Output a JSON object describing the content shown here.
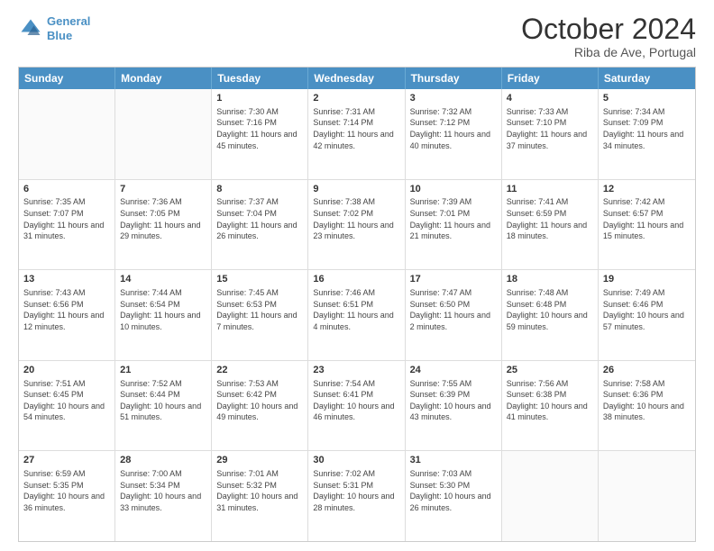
{
  "header": {
    "logo_line1": "General",
    "logo_line2": "Blue",
    "month_title": "October 2024",
    "location": "Riba de Ave, Portugal"
  },
  "days_of_week": [
    "Sunday",
    "Monday",
    "Tuesday",
    "Wednesday",
    "Thursday",
    "Friday",
    "Saturday"
  ],
  "weeks": [
    [
      {
        "day": "",
        "sunrise": "",
        "sunset": "",
        "daylight": ""
      },
      {
        "day": "",
        "sunrise": "",
        "sunset": "",
        "daylight": ""
      },
      {
        "day": "1",
        "sunrise": "Sunrise: 7:30 AM",
        "sunset": "Sunset: 7:16 PM",
        "daylight": "Daylight: 11 hours and 45 minutes."
      },
      {
        "day": "2",
        "sunrise": "Sunrise: 7:31 AM",
        "sunset": "Sunset: 7:14 PM",
        "daylight": "Daylight: 11 hours and 42 minutes."
      },
      {
        "day": "3",
        "sunrise": "Sunrise: 7:32 AM",
        "sunset": "Sunset: 7:12 PM",
        "daylight": "Daylight: 11 hours and 40 minutes."
      },
      {
        "day": "4",
        "sunrise": "Sunrise: 7:33 AM",
        "sunset": "Sunset: 7:10 PM",
        "daylight": "Daylight: 11 hours and 37 minutes."
      },
      {
        "day": "5",
        "sunrise": "Sunrise: 7:34 AM",
        "sunset": "Sunset: 7:09 PM",
        "daylight": "Daylight: 11 hours and 34 minutes."
      }
    ],
    [
      {
        "day": "6",
        "sunrise": "Sunrise: 7:35 AM",
        "sunset": "Sunset: 7:07 PM",
        "daylight": "Daylight: 11 hours and 31 minutes."
      },
      {
        "day": "7",
        "sunrise": "Sunrise: 7:36 AM",
        "sunset": "Sunset: 7:05 PM",
        "daylight": "Daylight: 11 hours and 29 minutes."
      },
      {
        "day": "8",
        "sunrise": "Sunrise: 7:37 AM",
        "sunset": "Sunset: 7:04 PM",
        "daylight": "Daylight: 11 hours and 26 minutes."
      },
      {
        "day": "9",
        "sunrise": "Sunrise: 7:38 AM",
        "sunset": "Sunset: 7:02 PM",
        "daylight": "Daylight: 11 hours and 23 minutes."
      },
      {
        "day": "10",
        "sunrise": "Sunrise: 7:39 AM",
        "sunset": "Sunset: 7:01 PM",
        "daylight": "Daylight: 11 hours and 21 minutes."
      },
      {
        "day": "11",
        "sunrise": "Sunrise: 7:41 AM",
        "sunset": "Sunset: 6:59 PM",
        "daylight": "Daylight: 11 hours and 18 minutes."
      },
      {
        "day": "12",
        "sunrise": "Sunrise: 7:42 AM",
        "sunset": "Sunset: 6:57 PM",
        "daylight": "Daylight: 11 hours and 15 minutes."
      }
    ],
    [
      {
        "day": "13",
        "sunrise": "Sunrise: 7:43 AM",
        "sunset": "Sunset: 6:56 PM",
        "daylight": "Daylight: 11 hours and 12 minutes."
      },
      {
        "day": "14",
        "sunrise": "Sunrise: 7:44 AM",
        "sunset": "Sunset: 6:54 PM",
        "daylight": "Daylight: 11 hours and 10 minutes."
      },
      {
        "day": "15",
        "sunrise": "Sunrise: 7:45 AM",
        "sunset": "Sunset: 6:53 PM",
        "daylight": "Daylight: 11 hours and 7 minutes."
      },
      {
        "day": "16",
        "sunrise": "Sunrise: 7:46 AM",
        "sunset": "Sunset: 6:51 PM",
        "daylight": "Daylight: 11 hours and 4 minutes."
      },
      {
        "day": "17",
        "sunrise": "Sunrise: 7:47 AM",
        "sunset": "Sunset: 6:50 PM",
        "daylight": "Daylight: 11 hours and 2 minutes."
      },
      {
        "day": "18",
        "sunrise": "Sunrise: 7:48 AM",
        "sunset": "Sunset: 6:48 PM",
        "daylight": "Daylight: 10 hours and 59 minutes."
      },
      {
        "day": "19",
        "sunrise": "Sunrise: 7:49 AM",
        "sunset": "Sunset: 6:46 PM",
        "daylight": "Daylight: 10 hours and 57 minutes."
      }
    ],
    [
      {
        "day": "20",
        "sunrise": "Sunrise: 7:51 AM",
        "sunset": "Sunset: 6:45 PM",
        "daylight": "Daylight: 10 hours and 54 minutes."
      },
      {
        "day": "21",
        "sunrise": "Sunrise: 7:52 AM",
        "sunset": "Sunset: 6:44 PM",
        "daylight": "Daylight: 10 hours and 51 minutes."
      },
      {
        "day": "22",
        "sunrise": "Sunrise: 7:53 AM",
        "sunset": "Sunset: 6:42 PM",
        "daylight": "Daylight: 10 hours and 49 minutes."
      },
      {
        "day": "23",
        "sunrise": "Sunrise: 7:54 AM",
        "sunset": "Sunset: 6:41 PM",
        "daylight": "Daylight: 10 hours and 46 minutes."
      },
      {
        "day": "24",
        "sunrise": "Sunrise: 7:55 AM",
        "sunset": "Sunset: 6:39 PM",
        "daylight": "Daylight: 10 hours and 43 minutes."
      },
      {
        "day": "25",
        "sunrise": "Sunrise: 7:56 AM",
        "sunset": "Sunset: 6:38 PM",
        "daylight": "Daylight: 10 hours and 41 minutes."
      },
      {
        "day": "26",
        "sunrise": "Sunrise: 7:58 AM",
        "sunset": "Sunset: 6:36 PM",
        "daylight": "Daylight: 10 hours and 38 minutes."
      }
    ],
    [
      {
        "day": "27",
        "sunrise": "Sunrise: 6:59 AM",
        "sunset": "Sunset: 5:35 PM",
        "daylight": "Daylight: 10 hours and 36 minutes."
      },
      {
        "day": "28",
        "sunrise": "Sunrise: 7:00 AM",
        "sunset": "Sunset: 5:34 PM",
        "daylight": "Daylight: 10 hours and 33 minutes."
      },
      {
        "day": "29",
        "sunrise": "Sunrise: 7:01 AM",
        "sunset": "Sunset: 5:32 PM",
        "daylight": "Daylight: 10 hours and 31 minutes."
      },
      {
        "day": "30",
        "sunrise": "Sunrise: 7:02 AM",
        "sunset": "Sunset: 5:31 PM",
        "daylight": "Daylight: 10 hours and 28 minutes."
      },
      {
        "day": "31",
        "sunrise": "Sunrise: 7:03 AM",
        "sunset": "Sunset: 5:30 PM",
        "daylight": "Daylight: 10 hours and 26 minutes."
      },
      {
        "day": "",
        "sunrise": "",
        "sunset": "",
        "daylight": ""
      },
      {
        "day": "",
        "sunrise": "",
        "sunset": "",
        "daylight": ""
      }
    ]
  ]
}
